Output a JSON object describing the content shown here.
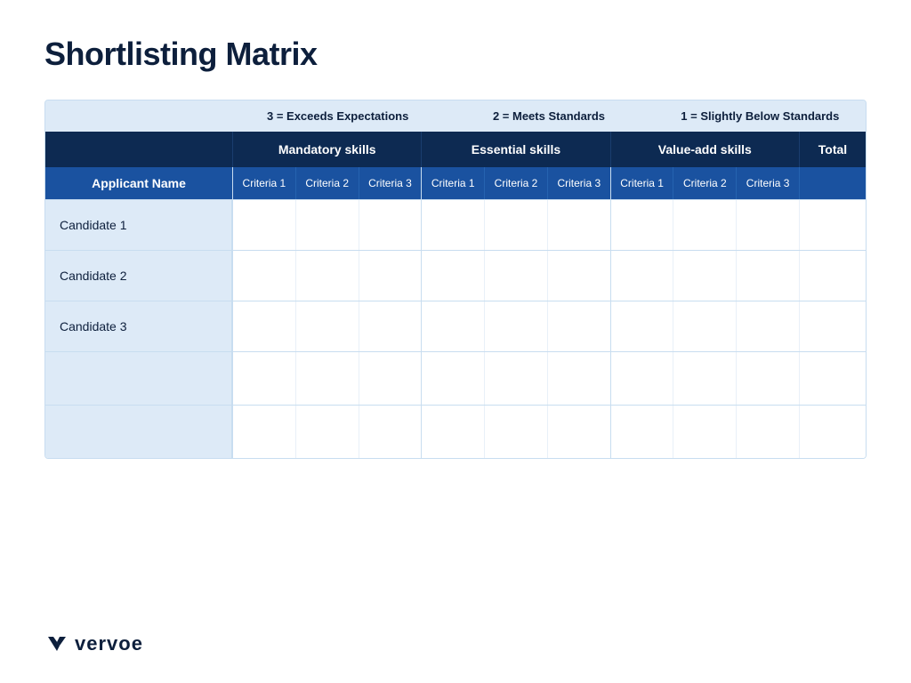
{
  "page": {
    "title": "Shortlisting Matrix",
    "background": "#ffffff"
  },
  "legend": {
    "item1": "3 = Exceeds Expectations",
    "item2": "2 = Meets Standards",
    "item3": "1 = Slightly Below Standards"
  },
  "table": {
    "headers": {
      "applicant_name": "Applicant Name",
      "mandatory_skills": "Mandatory skills",
      "essential_skills": "Essential skills",
      "value_add_skills": "Value-add skills",
      "total": "Total"
    },
    "criteria": {
      "c1": "Criteria 1",
      "c2": "Criteria 2",
      "c3": "Criteria 3"
    },
    "rows": [
      {
        "name": "Candidate 1"
      },
      {
        "name": "Candidate 2"
      },
      {
        "name": "Candidate 3"
      }
    ]
  },
  "logo": {
    "text": "vervoe"
  }
}
